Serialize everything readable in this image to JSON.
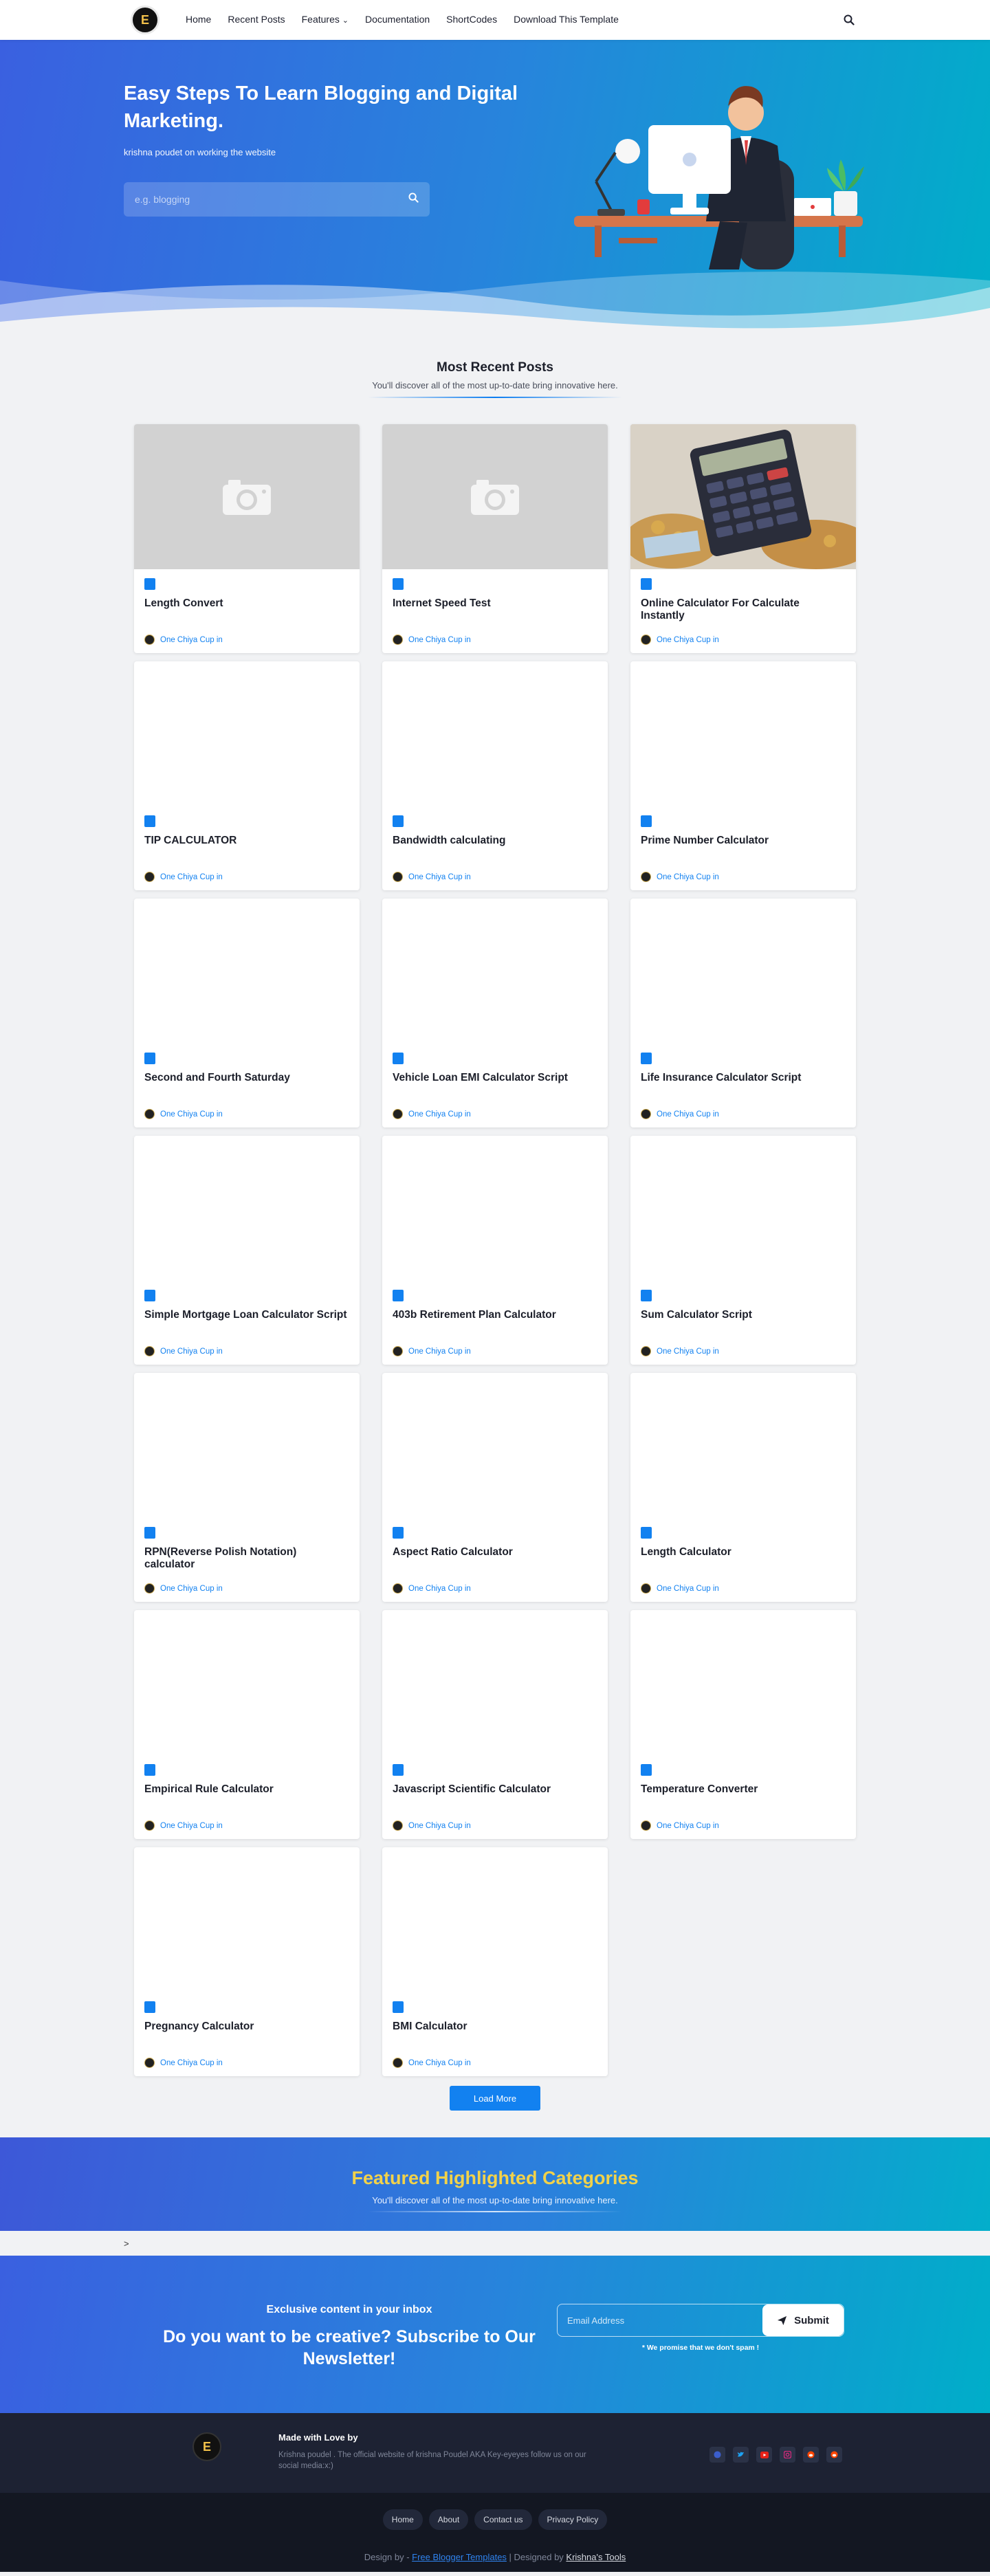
{
  "nav": {
    "logo": "E",
    "items": [
      "Home",
      "Recent Posts",
      "Features",
      "Documentation",
      "ShortCodes",
      "Download This Template"
    ],
    "features_caret": "⌄"
  },
  "hero": {
    "title": "Easy Steps To Learn Blogging and Digital Marketing.",
    "subtitle": "krishna poudet on working the website",
    "search_placeholder": "e.g. blogging"
  },
  "recent": {
    "title": "Most Recent Posts",
    "description": "You'll discover all of the most up-to-date bring innovative here."
  },
  "posts": [
    {
      "title": "Length Convert",
      "author": "One Chiya Cup in",
      "thumb": "placeholder"
    },
    {
      "title": "Internet Speed Test",
      "author": "One Chiya Cup in",
      "thumb": "placeholder"
    },
    {
      "title": "Online Calculator For Calculate Instantly",
      "author": "One Chiya Cup in",
      "thumb": "calculator"
    },
    {
      "title": "TIP CALCULATOR",
      "author": "One Chiya Cup in",
      "thumb": "none"
    },
    {
      "title": "Bandwidth calculating",
      "author": "One Chiya Cup in",
      "thumb": "none"
    },
    {
      "title": "Prime Number Calculator",
      "author": "One Chiya Cup in",
      "thumb": "none"
    },
    {
      "title": "Second and Fourth Saturday",
      "author": "One Chiya Cup in",
      "thumb": "none"
    },
    {
      "title": "Vehicle Loan EMI Calculator Script",
      "author": "One Chiya Cup in",
      "thumb": "none"
    },
    {
      "title": "Life Insurance Calculator Script",
      "author": "One Chiya Cup in",
      "thumb": "none"
    },
    {
      "title": "Simple Mortgage Loan Calculator Script",
      "author": "One Chiya Cup in",
      "thumb": "none"
    },
    {
      "title": "403b Retirement Plan Calculator",
      "author": "One Chiya Cup in",
      "thumb": "none"
    },
    {
      "title": "Sum Calculator Script",
      "author": "One Chiya Cup in",
      "thumb": "none"
    },
    {
      "title": "RPN(Reverse Polish Notation) calculator",
      "author": "One Chiya Cup in",
      "thumb": "none"
    },
    {
      "title": "Aspect Ratio Calculator",
      "author": "One Chiya Cup in",
      "thumb": "none"
    },
    {
      "title": "Length Calculator",
      "author": "One Chiya Cup in",
      "thumb": "none"
    },
    {
      "title": "Empirical Rule Calculator",
      "author": "One Chiya Cup in",
      "thumb": "none"
    },
    {
      "title": "Javascript Scientific Calculator",
      "author": "One Chiya Cup in",
      "thumb": "none"
    },
    {
      "title": "Temperature Converter",
      "author": "One Chiya Cup in",
      "thumb": "none"
    },
    {
      "title": "Pregnancy Calculator",
      "author": "One Chiya Cup in",
      "thumb": "none"
    },
    {
      "title": "BMI Calculator",
      "author": "One Chiya Cup in",
      "thumb": "none"
    }
  ],
  "load_more": "Load More",
  "featured": {
    "title": "Featured Highlighted Categories",
    "description": "You'll discover all of the most up-to-date bring innovative here."
  },
  "strip_text": ">",
  "newsletter": {
    "small": "Exclusive content in your inbox",
    "big": "Do you want to be creative? Subscribe to Our Newsletter!",
    "placeholder": "Email Address",
    "button": "Submit",
    "note": "* We promise that we don't spam !"
  },
  "footer": {
    "logo": "E",
    "about_title": "Made with Love by",
    "about_text": "Krishna poudel . The official website of krishna Poudel AKA Key-eyeyes follow us on our social media:x:)",
    "socials": [
      "facebook-icon",
      "twitter-icon",
      "youtube-icon",
      "instagram-icon",
      "reddit-icon",
      "reddit-icon"
    ],
    "links": [
      "Home",
      "About",
      "Contact us",
      "Privacy Policy"
    ],
    "credit_prefix": "Design by - ",
    "credit_link": "Free Blogger Templates",
    "credit_mid": " | Designed by ",
    "credit_author": "Krishna's Tools"
  },
  "colors": {
    "accent": "#1281f0",
    "featured_title": "#f2d24a",
    "footer_dark": "#1d2233"
  }
}
